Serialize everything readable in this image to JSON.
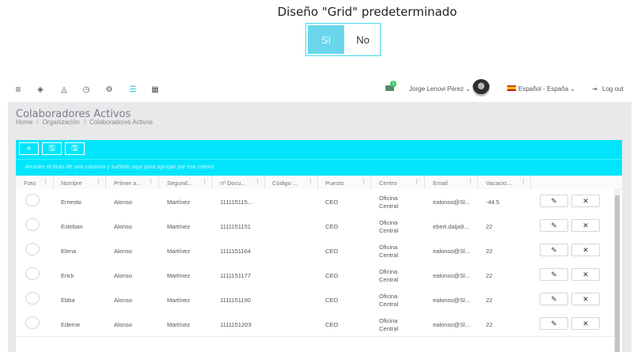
{
  "toggle": {
    "title": "Diseño \"Grid\" predeterminado",
    "yes": "Sí",
    "no": "No"
  },
  "nav": {
    "icons": [
      "menu-icon",
      "eye-icon",
      "bell-icon",
      "clock-icon",
      "gears-icon",
      "list-icon",
      "grid-icon"
    ],
    "mail_badge": "1",
    "user": "Jorge Lenovi Pérez ⌄",
    "language": "Español - España ⌄",
    "logout": "Log out"
  },
  "page": {
    "title": "Colaboradores Activos",
    "breadcrumb": [
      "Home",
      "Organización",
      "Colaboradores Activos"
    ]
  },
  "toolbar": {
    "add": "+",
    "save": "🖫",
    "export": "🖫"
  },
  "group_hint": "Arrastre el título de una columna y suéltelo aquí para agrupar por ese criterio",
  "columns": [
    "Foto",
    "Nombre",
    "Primer a...",
    "Segund...",
    "nº Docu...",
    "Código ...",
    "Puesto",
    "Centro",
    "Email",
    "Vacacio..."
  ],
  "rows": [
    {
      "nombre": "Ernesto",
      "primer": "Alonso",
      "segundo": "Martínez",
      "doc": "111115115...",
      "codigo": "",
      "puesto": "CEO",
      "centro1": "Oficina",
      "centro2": "Central",
      "email": "ealonso@Sl...",
      "vac": "-44.5"
    },
    {
      "nombre": "Esteban",
      "primer": "Alonso",
      "segundo": "Martínez",
      "doc": "1111151151",
      "codigo": "",
      "puesto": "CEO",
      "centro1": "Oficina",
      "centro2": "Central",
      "email": "ebert.daija9...",
      "vac": "22"
    },
    {
      "nombre": "Elena",
      "primer": "Alonso",
      "segundo": "Martínez",
      "doc": "1111151164",
      "codigo": "",
      "puesto": "CEO",
      "centro1": "Oficina",
      "centro2": "Central",
      "email": "ealonso@Sl...",
      "vac": "22"
    },
    {
      "nombre": "Erick",
      "primer": "Alonso",
      "segundo": "Martínez",
      "doc": "1111151177",
      "codigo": "",
      "puesto": "CEO",
      "centro1": "Oficina",
      "centro2": "Central",
      "email": "ealonso@Sl...",
      "vac": "22"
    },
    {
      "nombre": "Ebba",
      "primer": "Alonso",
      "segundo": "Martínez",
      "doc": "1111151190",
      "codigo": "",
      "puesto": "CEO",
      "centro1": "Oficina",
      "centro2": "Central",
      "email": "ealonso@Sl...",
      "vac": "22"
    },
    {
      "nombre": "Ederne",
      "primer": "Alonso",
      "segundo": "Martínez",
      "doc": "1111151203",
      "codigo": "",
      "puesto": "CEO",
      "centro1": "Oficina",
      "centro2": "Central",
      "email": "ealonso@Sl...",
      "vac": "22"
    }
  ],
  "actions": {
    "edit": "✎",
    "delete": "✕"
  },
  "colors": {
    "accent": "#00e5fb",
    "toggle_active": "#6ad6ec"
  }
}
